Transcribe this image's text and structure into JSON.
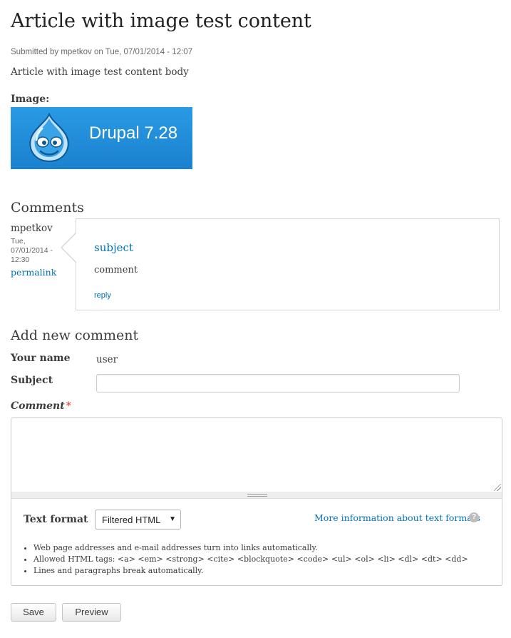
{
  "article": {
    "title": "Article with image test content",
    "submitted": "Submitted by mpetkov on Tue, 07/01/2014 - 12:07",
    "body": "Article with image test content body",
    "image_label": "Image:",
    "image_text": "Drupal 7.28",
    "brand_color": "#2a9ae4"
  },
  "comments": {
    "title": "Comments",
    "items": [
      {
        "author": "mpetkov",
        "date": "Tue, 07/01/2014 - 12:30",
        "permalink": "permalink",
        "subject": "subject",
        "text": "comment",
        "reply": "reply"
      }
    ]
  },
  "form": {
    "title": "Add new comment",
    "name_label": "Your name",
    "name_value": "user",
    "subject_label": "Subject",
    "subject_value": "",
    "comment_label": "Comment",
    "required_mark": "*",
    "comment_value": "",
    "text_format_label": "Text format",
    "text_format_selected": "Filtered HTML",
    "more_info": "More information about text formats",
    "help_icon": "?",
    "tips": [
      "Web page addresses and e-mail addresses turn into links automatically.",
      "Allowed HTML tags: <a> <em> <strong> <cite> <blockquote> <code> <ul> <ol> <li> <dl> <dt> <dd>",
      "Lines and paragraphs break automatically."
    ],
    "save": "Save",
    "preview": "Preview"
  },
  "colors": {
    "link": "#0071b3",
    "required": "#e74c3c"
  }
}
